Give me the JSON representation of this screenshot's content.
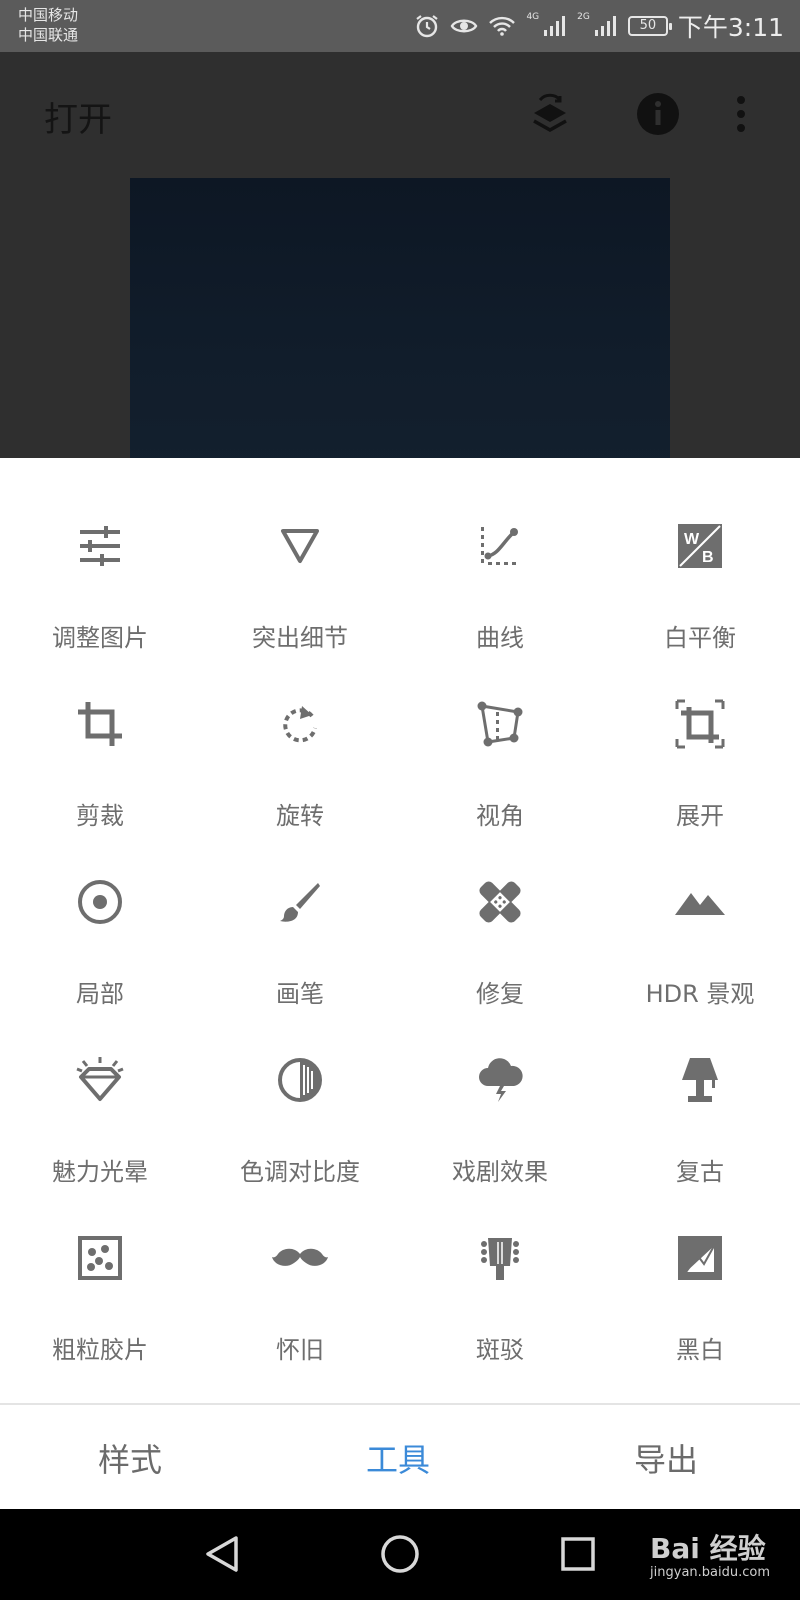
{
  "status_bar": {
    "carrier_1": "中国移动",
    "carrier_2": "中国联通",
    "net_1": "4G",
    "net_2": "2G",
    "battery": "50",
    "time": "下午3:11",
    "icons": [
      "alarm-icon",
      "eye-icon",
      "wifi-icon",
      "signal-icon",
      "signal-icon",
      "battery-icon"
    ]
  },
  "app_header": {
    "title": "打开",
    "icons": [
      "layers-icon",
      "info-icon",
      "more-vert-icon"
    ]
  },
  "tools": [
    {
      "label": "调整图片",
      "icon": "tune-sliders-icon"
    },
    {
      "label": "突出细节",
      "icon": "triangle-down-icon"
    },
    {
      "label": "曲线",
      "icon": "curve-icon"
    },
    {
      "label": "白平衡",
      "icon": "white-balance-icon"
    },
    {
      "label": "剪裁",
      "icon": "crop-icon"
    },
    {
      "label": "旋转",
      "icon": "rotate-icon"
    },
    {
      "label": "视角",
      "icon": "perspective-icon"
    },
    {
      "label": "展开",
      "icon": "expand-icon"
    },
    {
      "label": "局部",
      "icon": "selective-icon"
    },
    {
      "label": "画笔",
      "icon": "brush-icon"
    },
    {
      "label": "修复",
      "icon": "healing-icon"
    },
    {
      "label": "HDR 景观",
      "icon": "mountains-icon"
    },
    {
      "label": "魅力光晕",
      "icon": "diamond-glow-icon"
    },
    {
      "label": "色调对比度",
      "icon": "tonal-contrast-icon"
    },
    {
      "label": "戏剧效果",
      "icon": "storm-cloud-icon"
    },
    {
      "label": "复古",
      "icon": "lamp-icon"
    },
    {
      "label": "粗粒胶片",
      "icon": "grain-film-icon"
    },
    {
      "label": "怀旧",
      "icon": "mustache-icon"
    },
    {
      "label": "斑驳",
      "icon": "guitar-head-icon"
    },
    {
      "label": "黑白",
      "icon": "black-white-icon"
    }
  ],
  "tabs": [
    {
      "label": "样式",
      "active": false
    },
    {
      "label": "工具",
      "active": true
    },
    {
      "label": "导出",
      "active": false
    }
  ],
  "colors": {
    "accent": "#3b8ad8",
    "icon": "#6e6e6e",
    "dim": "#2f2f2f"
  },
  "nav_bar": {
    "icons": [
      "back-triangle-icon",
      "home-circle-icon",
      "recents-square-icon"
    ],
    "watermark_main": "Bai 经验",
    "watermark_url": "jingyan.baidu.com"
  }
}
